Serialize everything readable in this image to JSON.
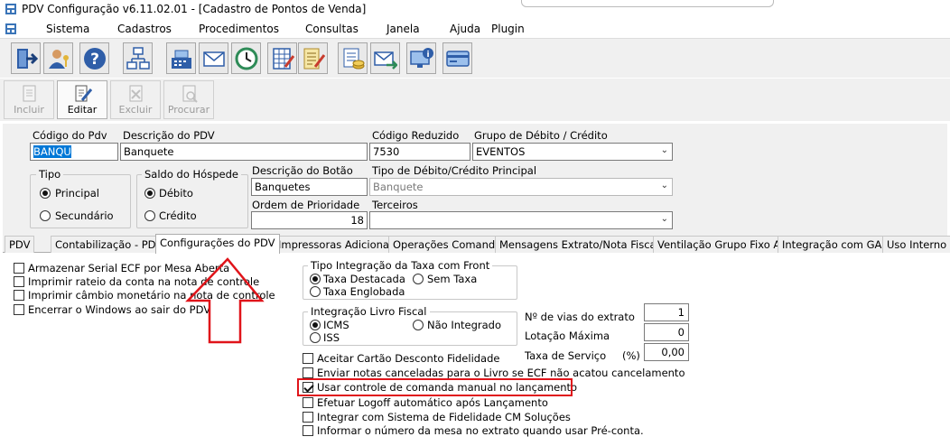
{
  "window": {
    "title": "PDV Configuração v6.11.02.01 - [Cadastro de Pontos de Venda]"
  },
  "menu": [
    "Sistema",
    "Cadastros",
    "Procedimentos",
    "Consultas",
    "Janela",
    "Ajuda",
    "Plugin"
  ],
  "toolbar_icons": [
    "exit-icon",
    "user-key-icon",
    "help-icon",
    "org-chart-icon",
    "cash-register-icon",
    "mail-icon",
    "clock-icon",
    "spreadsheet-pen-icon",
    "report-pen-icon",
    "cash-sheet-icon",
    "coins-sheet-icon",
    "mail-arrow-icon",
    "monitor-info-icon",
    "card-icon"
  ],
  "actions": {
    "incluir": "Incluir",
    "editar": "Editar",
    "excluir": "Excluir",
    "procurar": "Procurar"
  },
  "form": {
    "codigo_pdv_label": "Código do Pdv",
    "codigo_pdv_value": "BANQU",
    "descricao_pdv_label": "Descrição do PDV",
    "descricao_pdv_value": "Banquete",
    "codigo_reduzido_label": "Código Reduzido",
    "codigo_reduzido_value": "7530",
    "grupo_label": "Grupo de Débito / Crédito",
    "grupo_value": "EVENTOS",
    "tipo_label": "Tipo",
    "tipo_principal": "Principal",
    "tipo_secundario": "Secundário",
    "saldo_label": "Saldo do Hóspede",
    "saldo_debito": "Débito",
    "saldo_credito": "Crédito",
    "descricao_botao_label": "Descrição do Botão",
    "descricao_botao_value": "Banquetes",
    "tipo_debito_label": "Tipo de Débito/Crédito Principal",
    "tipo_debito_value": "Banquete",
    "ordem_label": "Ordem de Prioridade",
    "ordem_value": "18",
    "terceiros_label": "Terceiros",
    "terceiros_value": ""
  },
  "tabs": [
    "PDV",
    "Contabilização - PDV",
    "Configurações do PDV",
    "Impressoras Adicionais",
    "Operações Comanda",
    "Mensagens Extrato/Nota Fiscal",
    "Ventilação Grupo Fixo AB",
    "Integração com GAP",
    "Uso Interno"
  ],
  "config": {
    "left_checks": [
      "Armazenar Serial ECF por Mesa Aberta",
      "Imprimir rateio da conta na nota de controle",
      "Imprimir câmbio monetário na nota de controle",
      "Encerrar o Windows ao sair do PDV"
    ],
    "taxa_group_title": "Tipo Integração da Taxa com Front",
    "taxa_destacada": "Taxa Destacada",
    "sem_taxa": "Sem Taxa",
    "taxa_englobada": "Taxa Englobada",
    "livro_group_title": "Integração Livro Fiscal",
    "icms": "ICMS",
    "nao_integrado": "Não Integrado",
    "iss": "ISS",
    "vias_label": "Nº de vias do extrato",
    "vias_value": "1",
    "lotacao_label": "Lotação Máxima",
    "lotacao_value": "0",
    "taxa_servico_label": "Taxa de Serviço",
    "taxa_servico_unit": "(%)",
    "taxa_servico_value": "0,00",
    "bottom_checks": [
      {
        "label": "Aceitar Cartão Desconto Fidelidade",
        "checked": false
      },
      {
        "label": "Enviar notas canceladas para o Livro se ECF não acatou cancelamento",
        "checked": false
      },
      {
        "label": "Usar controle de comanda manual no lançamento",
        "checked": true
      },
      {
        "label": "Efetuar Logoff automático após Lançamento",
        "checked": false
      },
      {
        "label": "Integrar com Sistema de Fidelidade CM Soluções",
        "checked": false
      },
      {
        "label": "Informar o número da mesa no extrato quando usar Pré-conta.",
        "checked": false
      }
    ]
  },
  "colors": {
    "annotation_red": "#e0141a",
    "selection_blue": "#0078d7"
  }
}
